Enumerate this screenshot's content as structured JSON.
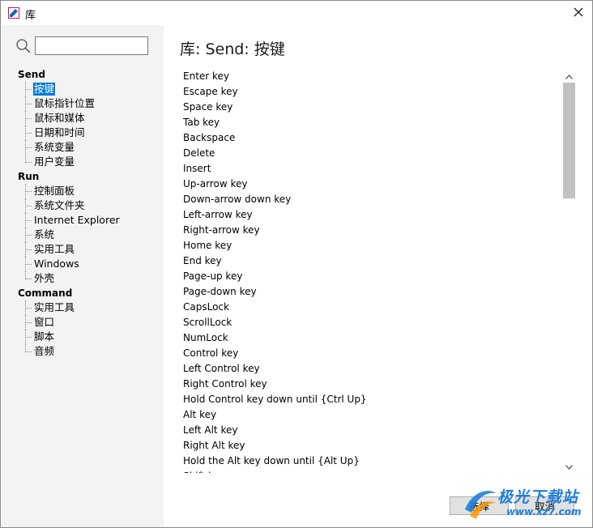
{
  "window": {
    "title": "库",
    "icon": "pencil-ruler-icon",
    "close_icon": "close-icon"
  },
  "search": {
    "icon": "search-icon",
    "value": "",
    "placeholder": ""
  },
  "tree": {
    "groups": [
      {
        "title": "Send",
        "items": [
          "按键",
          "鼠标指针位置",
          "鼠标和媒体",
          "日期和时间",
          "系统变量",
          "用户变量"
        ],
        "selected_index": 0
      },
      {
        "title": "Run",
        "items": [
          "控制面板",
          "系统文件夹",
          "Internet Explorer",
          "系统",
          "实用工具",
          "Windows",
          "外壳"
        ]
      },
      {
        "title": "Command",
        "items": [
          "实用工具",
          "窗口",
          "脚本",
          "音频"
        ]
      }
    ]
  },
  "main": {
    "heading": "库:  Send:  按键",
    "keys": [
      "Enter key",
      "Escape key",
      "Space key",
      "Tab key",
      "Backspace",
      "Delete",
      "Insert",
      "Up-arrow key",
      "Down-arrow down key",
      "Left-arrow key",
      "Right-arrow key",
      "Home key",
      "End key",
      "Page-up key",
      "Page-down key",
      "CapsLock",
      "ScrollLock",
      "NumLock",
      "Control key",
      "Left Control key",
      "Right Control key",
      "Hold Control key down until {Ctrl Up}",
      "Alt key",
      "Left Alt key",
      "Right Alt key",
      "Hold the Alt key down until {Alt Up}",
      "Shift key"
    ]
  },
  "buttons": {
    "ok_label": "选择",
    "cancel_label": "取消"
  },
  "watermark": {
    "text": "极光下载站",
    "url": "www.xz7.com"
  },
  "colors": {
    "selection": "#0078d7",
    "left_pane_bg": "#f3f3f3",
    "watermark": "#1e7fd8"
  }
}
